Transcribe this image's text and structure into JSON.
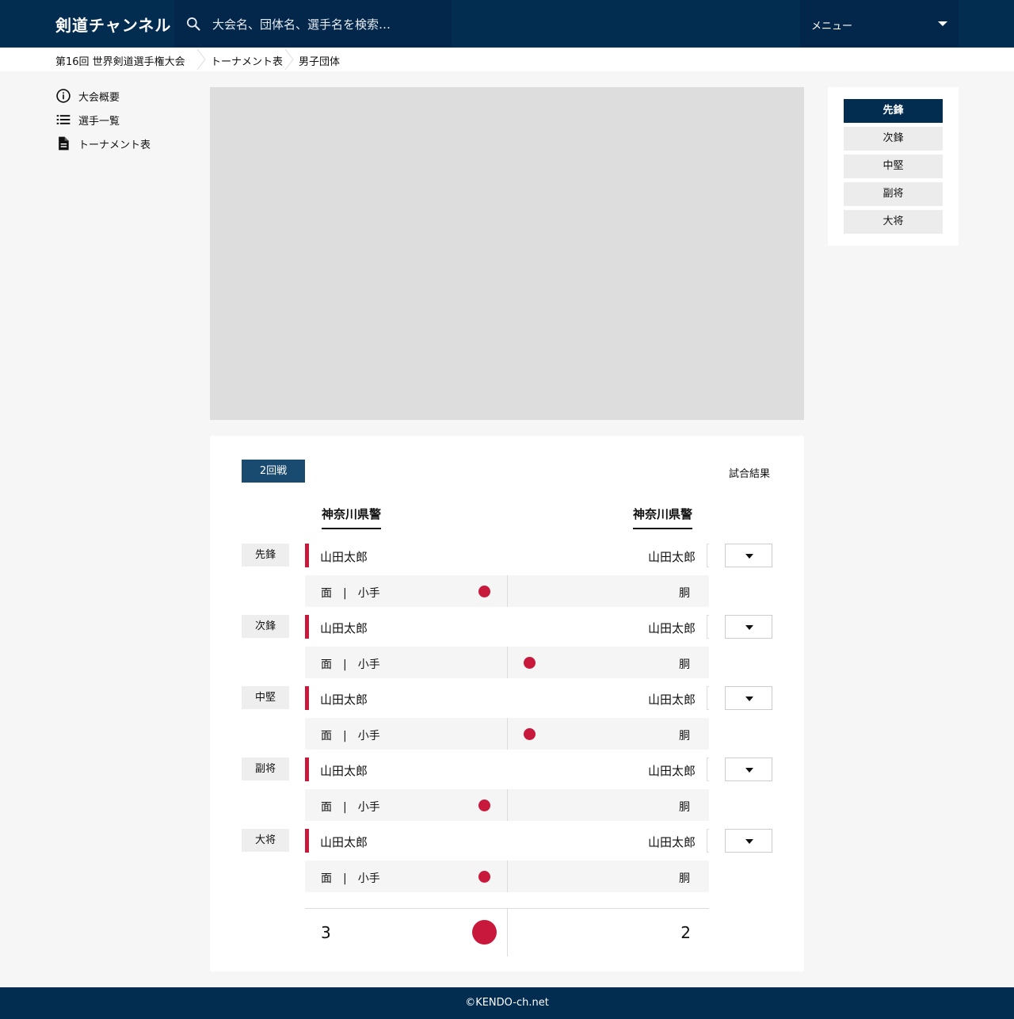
{
  "header": {
    "logo": "剣道チャンネル",
    "search_placeholder": "大会名、団体名、選手名を検索…",
    "menu_label": "メニュー"
  },
  "breadcrumb": [
    "第16回 世界剣道選手権大会",
    "トーナメント表",
    "男子団体"
  ],
  "nav": [
    {
      "label": "大会概要",
      "icon": "info-icon"
    },
    {
      "label": "選手一覧",
      "icon": "list-icon"
    },
    {
      "label": "トーナメント表",
      "icon": "document-icon"
    }
  ],
  "match": {
    "round": "2回戦",
    "result_label": "試合結果",
    "team_left": "神奈川県警",
    "team_right": "神奈川県警",
    "bouts": [
      {
        "position": "先鋒",
        "left_name": "山田太郎",
        "right_name": "山田太郎",
        "left_score": "面　|　小手",
        "right_score": "胴",
        "winner": "left"
      },
      {
        "position": "次鋒",
        "left_name": "山田太郎",
        "right_name": "山田太郎",
        "left_score": "面　|　小手",
        "right_score": "胴",
        "winner": "right"
      },
      {
        "position": "中堅",
        "left_name": "山田太郎",
        "right_name": "山田太郎",
        "left_score": "面　|　小手",
        "right_score": "胴",
        "winner": "right"
      },
      {
        "position": "副将",
        "left_name": "山田太郎",
        "right_name": "山田太郎",
        "left_score": "面　|　小手",
        "right_score": "胴",
        "winner": "left"
      },
      {
        "position": "大将",
        "left_name": "山田太郎",
        "right_name": "山田太郎",
        "left_score": "面　|　小手",
        "right_score": "胴",
        "winner": "left"
      }
    ],
    "total_left": "3",
    "total_right": "2",
    "total_winner": "left"
  },
  "position_tabs": [
    {
      "label": "先鋒",
      "active": true
    },
    {
      "label": "次鋒",
      "active": false
    },
    {
      "label": "中堅",
      "active": false
    },
    {
      "label": "副将",
      "active": false
    },
    {
      "label": "大将",
      "active": false
    }
  ],
  "footer": {
    "copyright": "©KENDO-ch.net"
  },
  "colors": {
    "navy": "#022c50",
    "accent_red": "#c8193c",
    "badge_blue": "#194a70"
  }
}
